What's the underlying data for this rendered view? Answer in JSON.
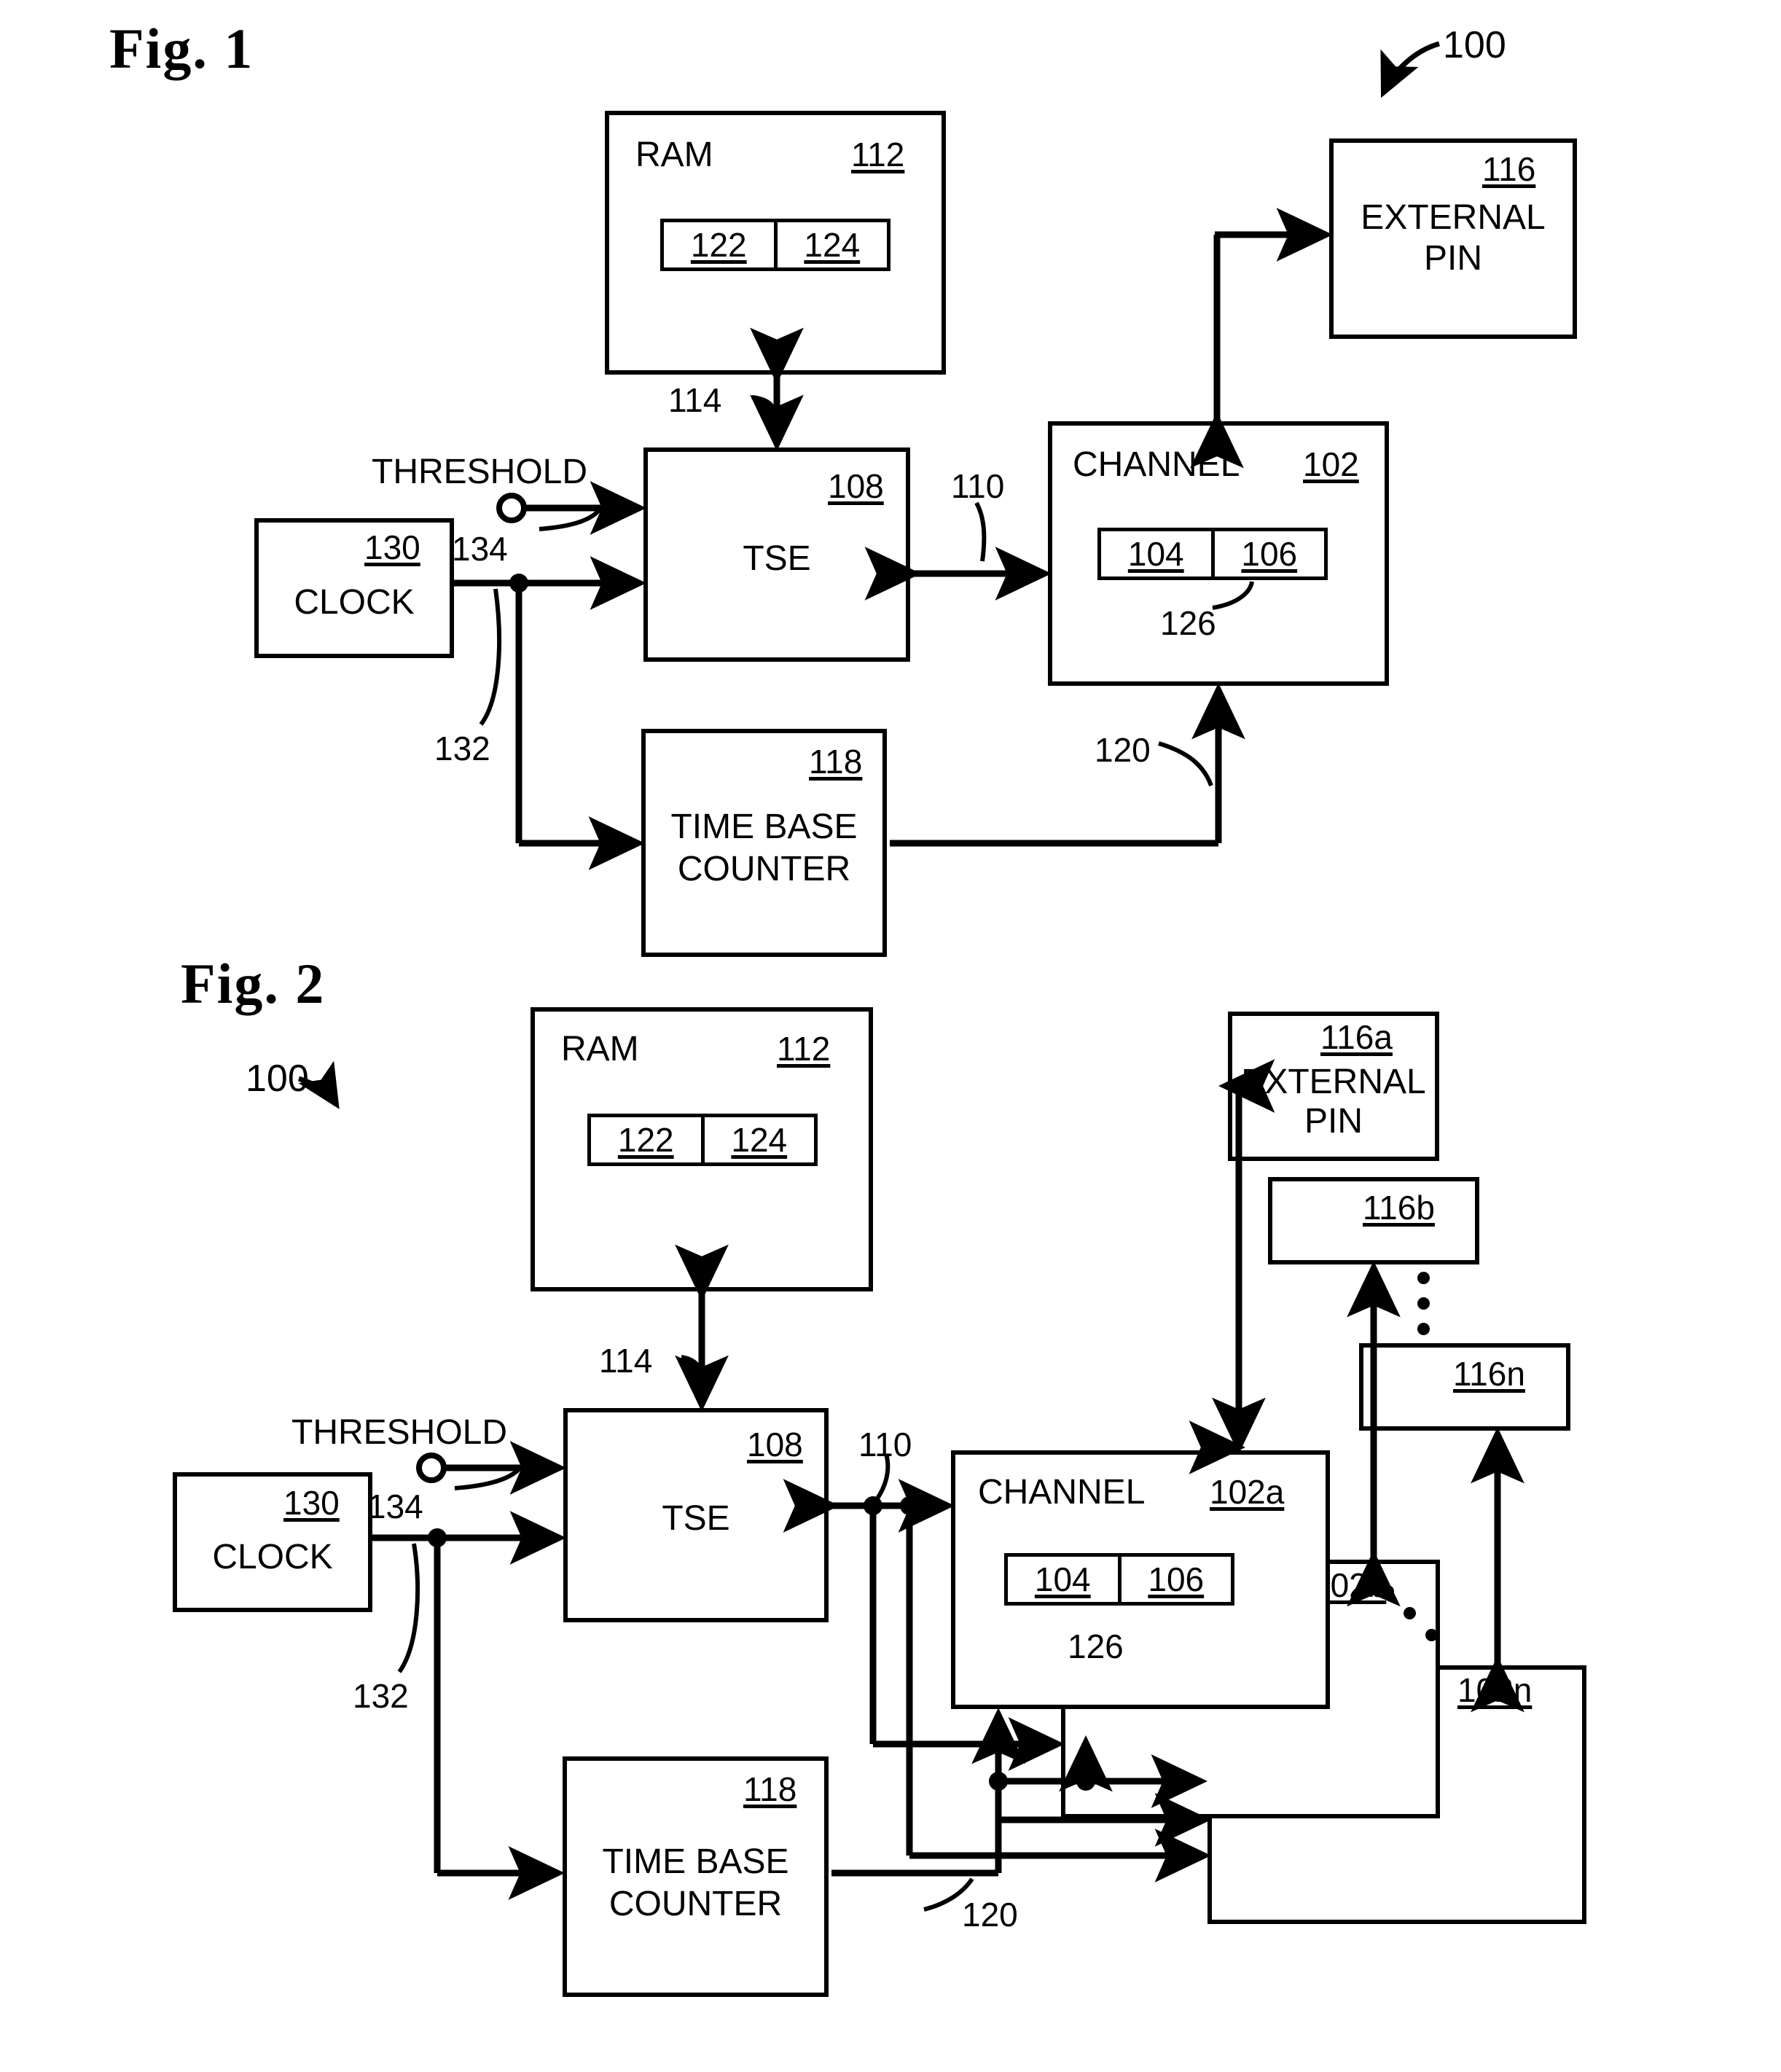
{
  "figures": [
    {
      "title": "Fig. 1",
      "system_ref": "100",
      "blocks": {
        "ram": {
          "name": "RAM",
          "ref": "112",
          "sub": [
            "122",
            "124"
          ]
        },
        "external_pin": {
          "name_line1": "EXTERNAL",
          "name_line2": "PIN",
          "ref": "116"
        },
        "tse": {
          "name": "TSE",
          "ref": "108"
        },
        "channel": {
          "name": "CHANNEL",
          "ref": "102",
          "sub": [
            "104",
            "106"
          ],
          "sub_ref": "126"
        },
        "clock": {
          "name": "CLOCK",
          "ref": "130"
        },
        "time_base_counter": {
          "name_line1": "TIME BASE",
          "name_line2": "COUNTER",
          "ref": "118"
        }
      },
      "signals": {
        "threshold_label": "THRESHOLD",
        "threshold_ref": "134",
        "clock_ref": "132",
        "ram_bus_ref": "114",
        "tse_channel_ref": "110",
        "counter_channel_ref": "120"
      }
    },
    {
      "title": "Fig. 2",
      "system_ref": "100",
      "blocks": {
        "ram": {
          "name": "RAM",
          "ref": "112",
          "sub": [
            "122",
            "124"
          ]
        },
        "external_pins": [
          {
            "name_line1": "EXTERNAL",
            "name_line2": "PIN",
            "ref": "116a"
          },
          {
            "name_line1": "",
            "name_line2": "",
            "ref": "116b"
          },
          {
            "name_line1": "",
            "name_line2": "",
            "ref": "116n"
          }
        ],
        "tse": {
          "name": "TSE",
          "ref": "108"
        },
        "channels": [
          {
            "name": "CHANNEL",
            "ref": "102a",
            "sub": [
              "104",
              "106"
            ],
            "sub_ref": "126"
          },
          {
            "name": "",
            "ref": "102b"
          },
          {
            "name": "",
            "ref": "102n"
          }
        ],
        "clock": {
          "name": "CLOCK",
          "ref": "130"
        },
        "time_base_counter": {
          "name_line1": "TIME BASE",
          "name_line2": "COUNTER",
          "ref": "118"
        }
      },
      "signals": {
        "threshold_label": "THRESHOLD",
        "threshold_ref": "134",
        "clock_ref": "132",
        "ram_bus_ref": "114",
        "tse_channel_ref": "110",
        "counter_channel_ref": "120"
      }
    }
  ]
}
